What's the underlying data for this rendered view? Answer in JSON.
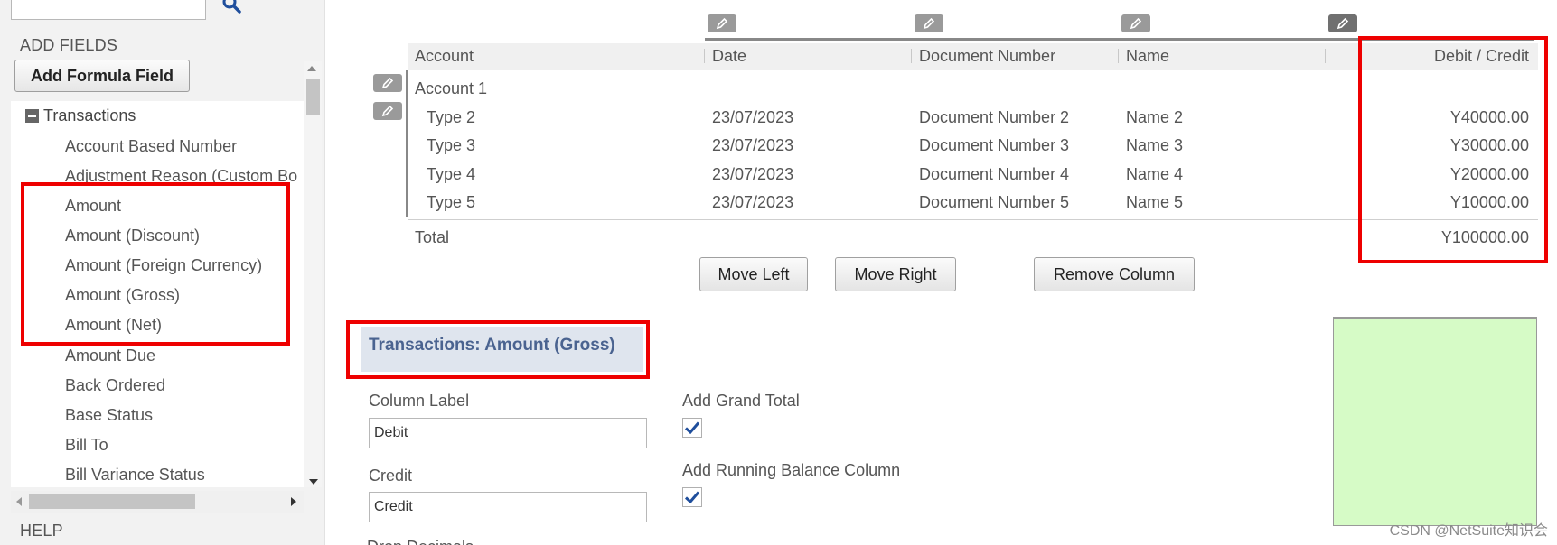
{
  "left_panel": {
    "search_placeholder": "",
    "add_fields_heading": "ADD FIELDS",
    "add_formula_button": "Add Formula Field",
    "tree_group_label": "Transactions",
    "fields": [
      "Account Based Number",
      "Adjustment Reason (Custom Bo",
      "Amount",
      "Amount (Discount)",
      "Amount (Foreign Currency)",
      "Amount (Gross)",
      "Amount (Net)",
      "Amount Due",
      "Back Ordered",
      "Base Status",
      "Bill To",
      "Bill Variance Status"
    ],
    "help_heading": "HELP"
  },
  "grid": {
    "columns": [
      "Account",
      "Date",
      "Document Number",
      "Name",
      "Debit / Credit"
    ],
    "account_row": "Account 1",
    "rows": [
      {
        "type": "Type 2",
        "date": "23/07/2023",
        "document": "Document Number 2",
        "name": "Name 2",
        "amount": "Y40000.00"
      },
      {
        "type": "Type 3",
        "date": "23/07/2023",
        "document": "Document Number 3",
        "name": "Name 3",
        "amount": "Y30000.00"
      },
      {
        "type": "Type 4",
        "date": "23/07/2023",
        "document": "Document Number 4",
        "name": "Name 4",
        "amount": "Y20000.00"
      },
      {
        "type": "Type 5",
        "date": "23/07/2023",
        "document": "Document Number 5",
        "name": "Name 5",
        "amount": "Y10000.00"
      }
    ],
    "total_label": "Total",
    "total_amount": "Y100000.00"
  },
  "actions": {
    "move_left": "Move Left",
    "move_right": "Move Right",
    "remove_column": "Remove Column"
  },
  "properties": {
    "title": "Transactions: Amount (Gross)",
    "column_label_caption": "Column Label",
    "column_label_value": "Debit",
    "credit_caption": "Credit",
    "credit_value": "Credit",
    "add_grand_total": "Add Grand Total",
    "add_grand_total_checked": true,
    "add_running_balance": "Add Running Balance Column",
    "add_running_balance_checked": true,
    "drop_decimals": "Drop Decimals"
  },
  "icons": {
    "search": "search-icon",
    "pencil": "pencil-icon",
    "check": "checkmark-icon",
    "collapse": "minus-icon"
  },
  "colors": {
    "highlight": "#ee0000",
    "title_text": "#4a6390",
    "preview_fill": "#d6fbc6",
    "check": "#1f4e9c"
  },
  "watermark": "CSDN @NetSuite知识会"
}
